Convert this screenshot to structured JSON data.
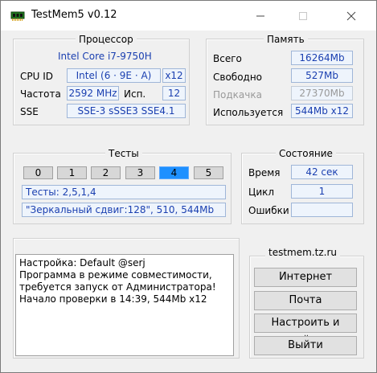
{
  "window": {
    "title": "TestMem5 v0.12",
    "minimize_icon": "minimize-icon",
    "maximize_icon": "maximize-icon",
    "close_icon": "close-icon"
  },
  "processor": {
    "group_title": "Процессор",
    "model": "Intel Core i7-9750H",
    "cpu_id_label": "CPU ID",
    "cpu_id_value": "Intel  (6 · 9E · A)",
    "cores_value": "x12",
    "freq_label": "Частота",
    "freq_value": "2592 MHz",
    "used_label": "Исп.",
    "used_value": "12",
    "sse_label": "SSE",
    "sse_value": "SSE-3 sSSE3 SSE4.1"
  },
  "memory": {
    "group_title": "Память",
    "total_label": "Всего",
    "total_value": "16264Mb",
    "free_label": "Свободно",
    "free_value": "527Mb",
    "swap_label": "Подкачка",
    "swap_value": "27370Mb",
    "used_label": "Используется",
    "used_value": "544Mb x12"
  },
  "tests": {
    "group_title": "Тесты",
    "tabs": [
      "0",
      "1",
      "2",
      "3",
      "4",
      "5"
    ],
    "active_index": 4,
    "sequence": "Тесты: 2,5,1,4",
    "current": "\"Зеркальный сдвиг:128\", 510, 544Mb"
  },
  "status": {
    "group_title": "Состояние",
    "time_label": "Время",
    "time_value": "42 сек",
    "cycle_label": "Цикл",
    "cycle_value": "1",
    "errors_label": "Ошибки",
    "errors_value": ""
  },
  "log": {
    "text": "Настройка: Default @serj\nПрограмма в режиме совместимости,\nтребуется запуск от Администратора!\nНачало проверки в 14:39, 544Mb x12"
  },
  "links": {
    "site": "testmem.tz.ru",
    "internet_button": "Интернет",
    "mail_button": "Почта",
    "configure_exit_button": "Настроить и выйти",
    "exit_button": "Выйти"
  }
}
